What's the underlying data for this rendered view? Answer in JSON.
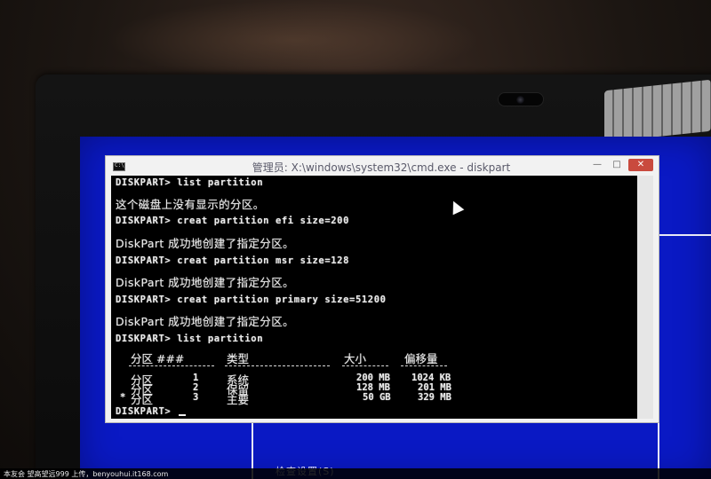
{
  "window": {
    "title": "管理员: X:\\windows\\system32\\cmd.exe - diskpart",
    "buttons": {
      "minimize": "—",
      "maximize": "□",
      "close": "✕"
    }
  },
  "console": {
    "lines": [
      "DISKPART> list partition",
      "这个磁盘上没有显示的分区。",
      "DISKPART> creat partition efi size=200",
      "DiskPart 成功地创建了指定分区。",
      "DISKPART> creat partition msr size=128",
      "DiskPart 成功地创建了指定分区。",
      "DISKPART> creat partition primary size=51200",
      "DiskPart 成功地创建了指定分区。",
      "DISKPART> list partition"
    ],
    "table": {
      "headers": [
        "分区 ###",
        "类型",
        "大小",
        "偏移量"
      ],
      "rows": [
        {
          "marker": "",
          "label": "分区",
          "num": "1",
          "type": "系统",
          "size": "200 MB",
          "offset": "1024 KB"
        },
        {
          "marker": "",
          "label": "分区",
          "num": "2",
          "type": "保留",
          "size": "128 MB",
          "offset": "201 MB"
        },
        {
          "marker": "*",
          "label": "分区",
          "num": "3",
          "type": "主要",
          "size": "50 GB",
          "offset": "329 MB"
        }
      ]
    },
    "prompt": "DISKPART> "
  },
  "setup": {
    "bottom_text": "检查设置(S)"
  },
  "footer": {
    "text": "本友会 望高望远999 上传，benyouhui.it168.com"
  },
  "colors": {
    "setup_background": "#0a19c4",
    "console_background": "#000000",
    "console_text": "#e9e9e9"
  }
}
